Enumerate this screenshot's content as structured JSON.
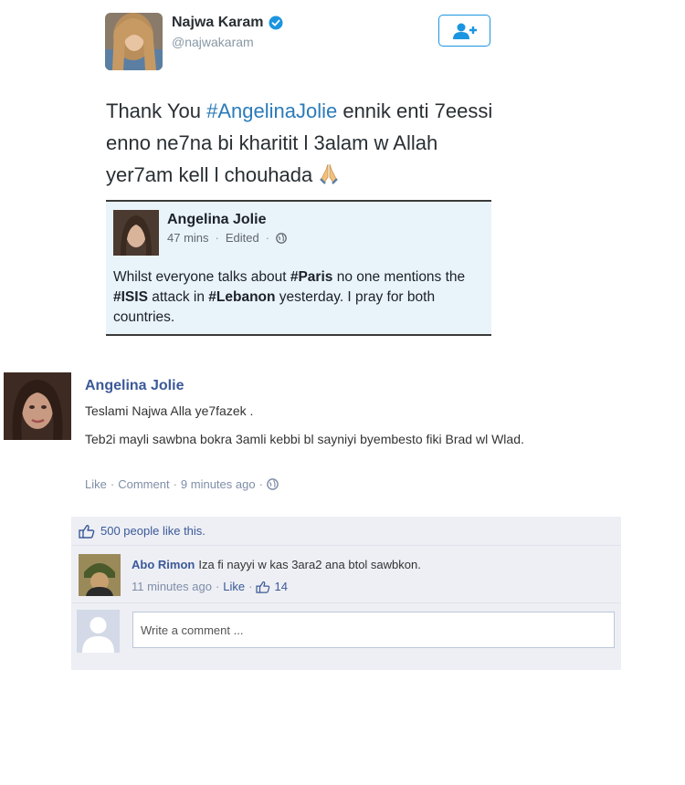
{
  "tweet": {
    "author_name": "Najwa Karam",
    "author_handle": "@najwakaram",
    "text_before_hashtag": "Thank You ",
    "hashtag": "#AngelinaJolie",
    "text_after_hashtag": " ennik enti 7eessi enno ne7na bi kharitit l 3alam w Allah yer7am kell l chouhada",
    "follow_icon": "add-user-icon",
    "verified_icon": "verified-badge-icon",
    "emoji_icon": "praying-hands-icon"
  },
  "embedded_post": {
    "author_name": "Angelina Jolie",
    "time": "47 mins",
    "edited": "Edited",
    "text": {
      "part1": "Whilst everyone talks about ",
      "tag1": "#Paris",
      "part2": " no one mentions the ",
      "tag2": "#ISIS",
      "part3": " attack in ",
      "tag3": "#Lebanon",
      "part4": " yesterday. I pray for both countries."
    }
  },
  "fb_comment": {
    "author_name": "Angelina Jolie",
    "line1": "Teslami Najwa Alla ye7fazek .",
    "line2": "Teb2i mayli sawbna bokra 3amli kebbi bl sayniyi byembesto fiki Brad wl Wlad.",
    "like_label": "Like",
    "comment_label": "Comment",
    "time": "9 minutes ago"
  },
  "likes": {
    "text": "500 people like this."
  },
  "reply": {
    "author_name": "Abo Rimon",
    "text": "Iza fi nayyi w kas 3ara2 ana btol sawbkon.",
    "time": "11 minutes ago",
    "like_label": "Like",
    "like_count": "14"
  },
  "write_comment": {
    "placeholder": "Write a comment ..."
  },
  "colors": {
    "twitter_blue": "#1b95e0",
    "hashtag": "#2b7bb9",
    "fb_blue": "#3b5998",
    "fb_panel": "#edeff4"
  }
}
